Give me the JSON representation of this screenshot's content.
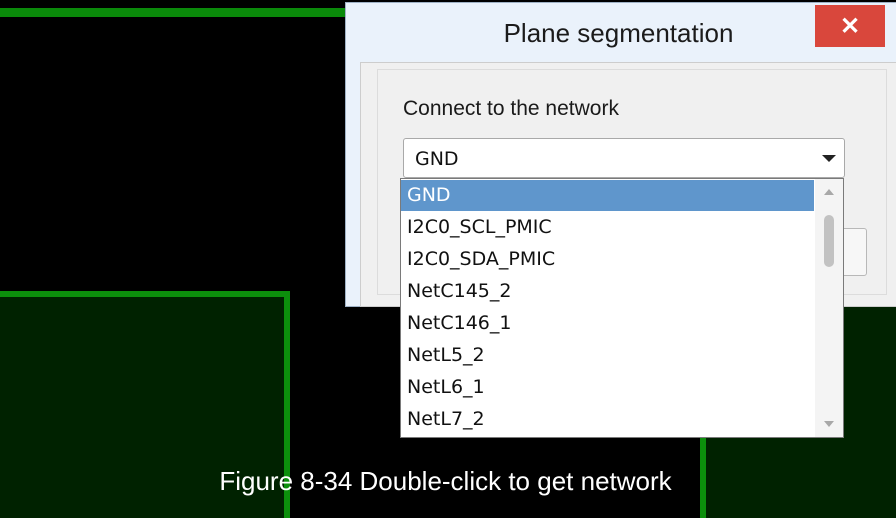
{
  "dialog": {
    "title": "Plane segmentation",
    "close_label": "✕",
    "field_label": "Connect to the network",
    "selected_value": "GND"
  },
  "dropdown": {
    "items": [
      "GND",
      "I2C0_SCL_PMIC",
      "I2C0_SDA_PMIC",
      "NetC145_2",
      "NetC146_1",
      "NetL5_2",
      "NetL6_1",
      "NetL7_2"
    ],
    "highlighted_index": 0
  },
  "caption": "Figure 8-34  Double-click to get network",
  "colors": {
    "pcb_background": "#000000",
    "copper_outline": "#0c8f0c",
    "selection_highlight": "#5f96cc",
    "close_button": "#d9473c"
  }
}
